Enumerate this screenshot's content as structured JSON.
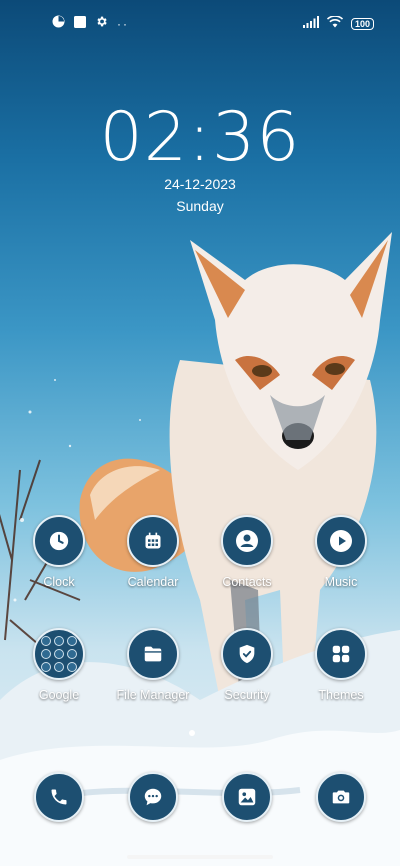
{
  "status_bar": {
    "battery": "100"
  },
  "lock": {
    "time": "02:36",
    "date": "24-12-2023",
    "day": "Sunday"
  },
  "apps_row1": [
    {
      "label": "Clock",
      "icon": "clock-icon"
    },
    {
      "label": "Calendar",
      "icon": "calendar-icon"
    },
    {
      "label": "Contacts",
      "icon": "contacts-icon"
    },
    {
      "label": "Music",
      "icon": "play-icon"
    }
  ],
  "apps_row2": [
    {
      "label": "Google",
      "icon": "google-folder-icon"
    },
    {
      "label": "File Manager",
      "icon": "folder-icon"
    },
    {
      "label": "Security",
      "icon": "shield-icon"
    },
    {
      "label": "Themes",
      "icon": "grid-icon"
    }
  ],
  "dock": [
    {
      "icon": "phone-icon"
    },
    {
      "icon": "message-icon"
    },
    {
      "icon": "gallery-icon"
    },
    {
      "icon": "camera-icon"
    }
  ],
  "colors": {
    "icon_bg": "#1d4f71",
    "icon_border": "#e6f0f6"
  }
}
